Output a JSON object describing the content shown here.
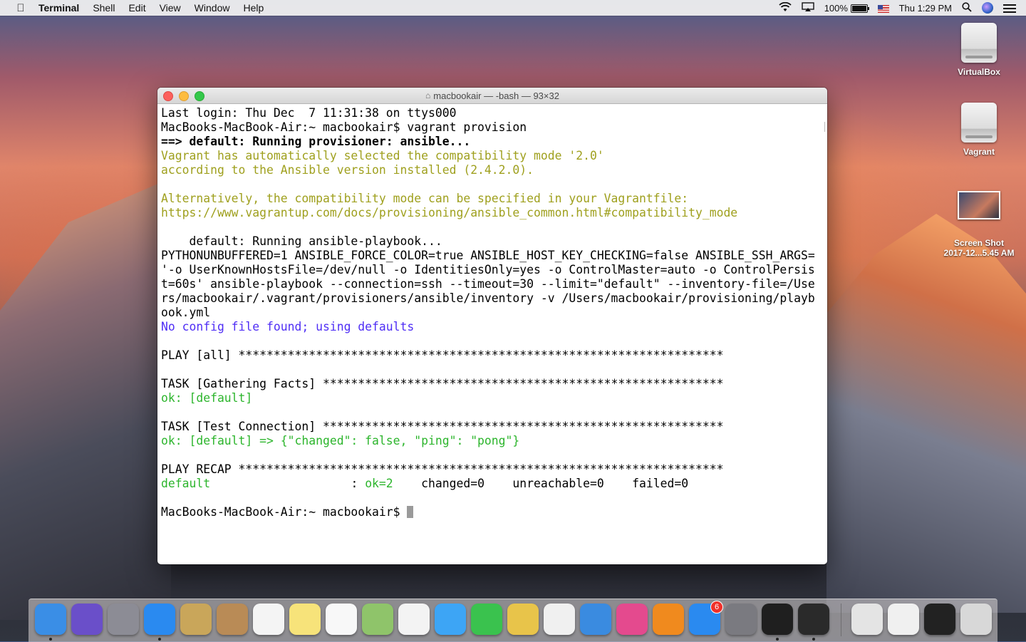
{
  "menubar": {
    "app_name": "Terminal",
    "menus": [
      "Shell",
      "Edit",
      "View",
      "Window",
      "Help"
    ],
    "battery": "100%",
    "battery_level": 1.0,
    "clock": "Thu 1:29 PM"
  },
  "desktop_icons": [
    {
      "label": "VirtualBox",
      "icon": "hard-disk-icon"
    },
    {
      "label": "Vagrant",
      "icon": "hard-disk-icon"
    },
    {
      "label_line1": "Screen Shot",
      "label_line2": "2017-12...5.45 AM",
      "icon": "screenshot-thumbnail"
    }
  ],
  "window": {
    "title": "macbookair — -bash — 93×32"
  },
  "terminal": {
    "lines": [
      {
        "text": "Last login: Thu Dec  7 11:31:38 on ttys000",
        "style": ""
      },
      {
        "text": "MacBooks-MacBook-Air:~ macbookair$ vagrant provision",
        "style": ""
      },
      {
        "text": "==> default: Running provisioner: ansible...",
        "style": "c-bold"
      },
      {
        "text": "Vagrant has automatically selected the compatibility mode '2.0'",
        "style": "c-yellow"
      },
      {
        "text": "according to the Ansible version installed (2.4.2.0).",
        "style": "c-yellow"
      },
      {
        "text": "",
        "style": ""
      },
      {
        "text": "Alternatively, the compatibility mode can be specified in your Vagrantfile:",
        "style": "c-yellow"
      },
      {
        "text": "https://www.vagrantup.com/docs/provisioning/ansible_common.html#compatibility_mode",
        "style": "c-yellow"
      },
      {
        "text": "",
        "style": ""
      },
      {
        "text": "    default: Running ansible-playbook...",
        "style": ""
      },
      {
        "text": "PYTHONUNBUFFERED=1 ANSIBLE_FORCE_COLOR=true ANSIBLE_HOST_KEY_CHECKING=false ANSIBLE_SSH_ARGS=",
        "style": ""
      },
      {
        "text": "'-o UserKnownHostsFile=/dev/null -o IdentitiesOnly=yes -o ControlMaster=auto -o ControlPersis",
        "style": ""
      },
      {
        "text": "t=60s' ansible-playbook --connection=ssh --timeout=30 --limit=\"default\" --inventory-file=/Use",
        "style": ""
      },
      {
        "text": "rs/macbookair/.vagrant/provisioners/ansible/inventory -v /Users/macbookair/provisioning/playb",
        "style": ""
      },
      {
        "text": "ook.yml",
        "style": ""
      },
      {
        "text": "No config file found; using defaults",
        "style": "c-purple"
      },
      {
        "text": "",
        "style": ""
      },
      {
        "text": "PLAY [all] *********************************************************************",
        "style": ""
      },
      {
        "text": "",
        "style": ""
      },
      {
        "text": "TASK [Gathering Facts] *********************************************************",
        "style": ""
      },
      {
        "text": "ok: [default]",
        "style": "c-green"
      },
      {
        "text": "",
        "style": ""
      },
      {
        "text": "TASK [Test Connection] *********************************************************",
        "style": ""
      },
      {
        "text": "ok: [default] => {\"changed\": false, \"ping\": \"pong\"}",
        "style": "c-green"
      },
      {
        "text": "",
        "style": ""
      },
      {
        "text": "PLAY RECAP *********************************************************************",
        "style": ""
      }
    ],
    "recap": {
      "host": "default",
      "sep": "                    : ",
      "ok": "ok=2",
      "rest": "    changed=0    unreachable=0    failed=0"
    },
    "prompt": "MacBooks-MacBook-Air:~ macbookair$ "
  },
  "dock": {
    "items": [
      {
        "name": "finder-icon",
        "color": "#3a8ee6",
        "running": true
      },
      {
        "name": "siri-icon",
        "color": "#6a4fc9",
        "running": false
      },
      {
        "name": "launchpad-icon",
        "color": "#8c8c95",
        "running": false
      },
      {
        "name": "safari-icon",
        "color": "#2a8af0",
        "running": true
      },
      {
        "name": "mail-icon",
        "color": "#c9a65a",
        "running": false
      },
      {
        "name": "contacts-icon",
        "color": "#b98b56",
        "running": false
      },
      {
        "name": "calendar-icon",
        "color": "#f4f4f4",
        "running": false
      },
      {
        "name": "notes-icon",
        "color": "#f7e37a",
        "running": false
      },
      {
        "name": "reminders-icon",
        "color": "#f8f8f8",
        "running": false
      },
      {
        "name": "maps-icon",
        "color": "#8fc46a",
        "running": false
      },
      {
        "name": "photos-icon",
        "color": "#f3f3f3",
        "running": false
      },
      {
        "name": "messages-icon",
        "color": "#3da5f5",
        "running": false
      },
      {
        "name": "facetime-icon",
        "color": "#3ac24e",
        "running": false
      },
      {
        "name": "photo-booth-icon",
        "color": "#e8c44a",
        "running": false
      },
      {
        "name": "numbers-icon",
        "color": "#f0f0f0",
        "running": false
      },
      {
        "name": "keynote-icon",
        "color": "#3a8be0",
        "running": false
      },
      {
        "name": "itunes-icon",
        "color": "#e44a8e",
        "running": false
      },
      {
        "name": "ibooks-icon",
        "color": "#f08a1e",
        "running": false
      },
      {
        "name": "app-store-icon",
        "color": "#2a8af0",
        "running": false,
        "badge": "6"
      },
      {
        "name": "system-preferences-icon",
        "color": "#7a7a80",
        "running": false
      },
      {
        "name": "terminal-icon",
        "color": "#1f1f1f",
        "running": true
      },
      {
        "name": "console-icon",
        "color": "#2a2a2a",
        "running": true
      }
    ],
    "right_items": [
      {
        "name": "documents-stack-icon",
        "color": "#e4e4e4"
      },
      {
        "name": "downloads-stack-icon",
        "color": "#f0f0f0"
      },
      {
        "name": "screenshot-stack-icon",
        "color": "#222"
      },
      {
        "name": "trash-icon",
        "color": "#d8d8d8"
      }
    ]
  }
}
